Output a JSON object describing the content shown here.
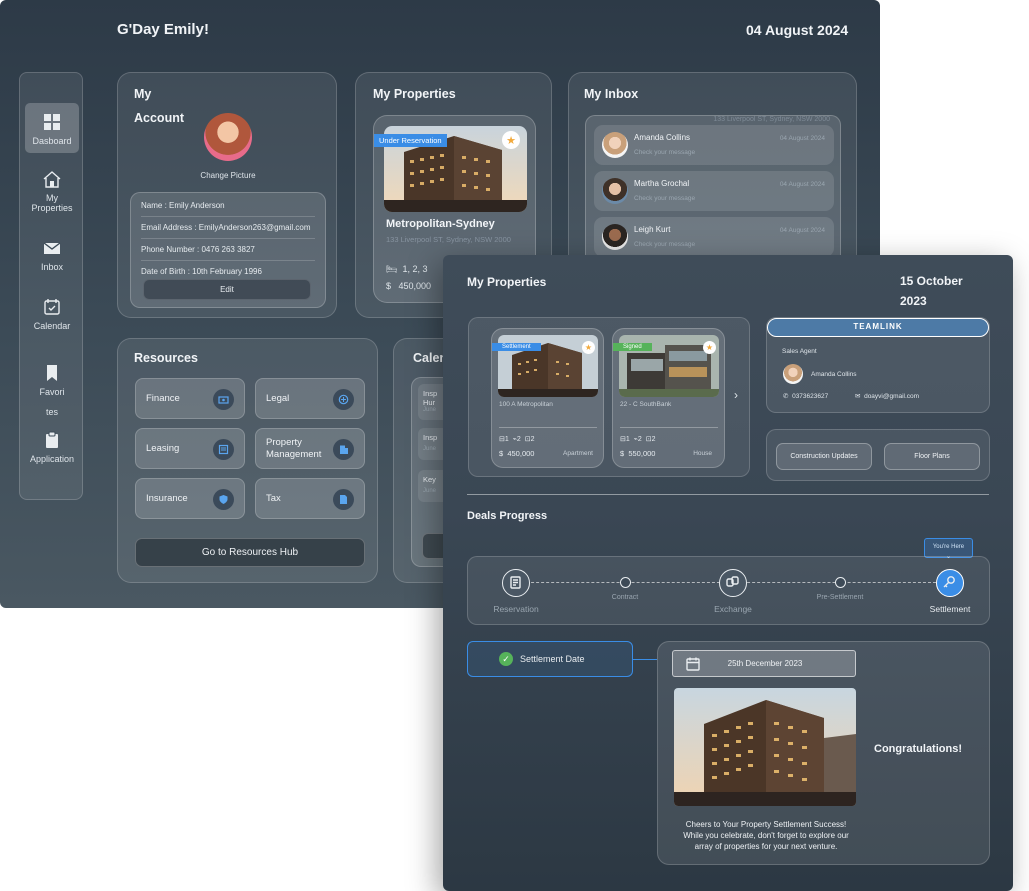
{
  "screen1": {
    "greeting": "G'Day Emily!",
    "date": "04 August 2024",
    "sidebar": {
      "items": [
        {
          "label": "Dasboard",
          "icon": "grid-icon"
        },
        {
          "label": "My Properties",
          "icon": "house-icon"
        },
        {
          "label": "Inbox",
          "icon": "mail-icon"
        },
        {
          "label": "Calendar",
          "icon": "calendar-icon"
        },
        {
          "label": "Favorites",
          "icon": "bookmark-icon"
        },
        {
          "label": "Application",
          "icon": "clipboard-icon"
        }
      ],
      "favorites_line1": "Favori",
      "favorites_line2": "tes",
      "properties_line1": "My",
      "properties_line2": "Properties"
    },
    "account": {
      "title_line1": "My",
      "title_line2": "Account",
      "change_picture": "Change Picture",
      "name": "Name :    Emily Anderson",
      "email": "Email Address : EmilyAnderson263@gmail.com",
      "phone": "Phone Number :  0476 263 3827",
      "dob": "Date of Birth : 10th February 1996",
      "edit": "Edit"
    },
    "properties": {
      "title": "My Properties",
      "badge": "Under Reservation",
      "name": "Metropolitan-Sydney",
      "address": "133 Liverpool ST, Sydney, NSW 2000",
      "rooms": "1, 2, 3",
      "price": "450,000"
    },
    "inbox": {
      "title": "My Inbox",
      "overflow_text": "133 Liverpool ST, Sydney, NSW 2000",
      "messages": [
        {
          "name": "Amanda Collins",
          "sub": "Check your message",
          "date": "04 August 2024"
        },
        {
          "name": "Martha Grochal",
          "sub": "Check your message",
          "date": "04 August 2024"
        },
        {
          "name": "Leigh Kurt",
          "sub": "Check your message",
          "date": "04 August 2024"
        }
      ]
    },
    "resources": {
      "title": "Resources",
      "items": [
        "Finance",
        "Legal",
        "Leasing",
        "Property Management",
        "Insurance",
        "Tax"
      ],
      "pm_line1": "Property",
      "pm_line2": "Management",
      "hub_button": "Go to Resources Hub"
    },
    "calendar": {
      "title": "Calen",
      "items": [
        {
          "l1": "Insp",
          "l2": "Hur",
          "l3": "June"
        },
        {
          "l1": "Insp",
          "l2": "June"
        },
        {
          "l1": "Key",
          "l2": "June"
        }
      ]
    }
  },
  "screen2": {
    "title": "My Properties",
    "date_line1": "15 October",
    "date_line2": "2023",
    "cards": [
      {
        "badge": "Settlement",
        "badge_color": "#3a8de6",
        "name": "100 A Metropolitan",
        "beds": "1",
        "baths": "2",
        "cars": "2",
        "price": "450,000",
        "type": "Apartment"
      },
      {
        "badge": "Signed",
        "badge_color": "#56b35a",
        "name": "22 - C SouthBank",
        "beds": "1",
        "baths": "2",
        "cars": "2",
        "price": "550,000",
        "type": "House"
      }
    ],
    "agent": {
      "brand": "TEAMLINK",
      "label": "Sales Agent",
      "name": "Amanda Collins",
      "phone": "0373623627",
      "email": "doayvi@gmail.com"
    },
    "buttons": {
      "construction": "Construction Updates",
      "floor_plans": "Floor Plans"
    },
    "deals": {
      "title": "Deals Progress",
      "you_are_here": "You're Here",
      "steps": [
        "Reservation",
        "Contract",
        "Exchange",
        "Pre-Settlement",
        "Settlement"
      ]
    },
    "settlement": {
      "label": "Settlement Date",
      "date": "25th December 2023",
      "congrats": "Congratulations!",
      "message_line1": "Cheers to Your Property Settlement Success!",
      "message_line2": "While you celebrate, don't forget to explore our",
      "message_line3": "array of properties for your next venture."
    },
    "accent": "#3a8de6"
  }
}
